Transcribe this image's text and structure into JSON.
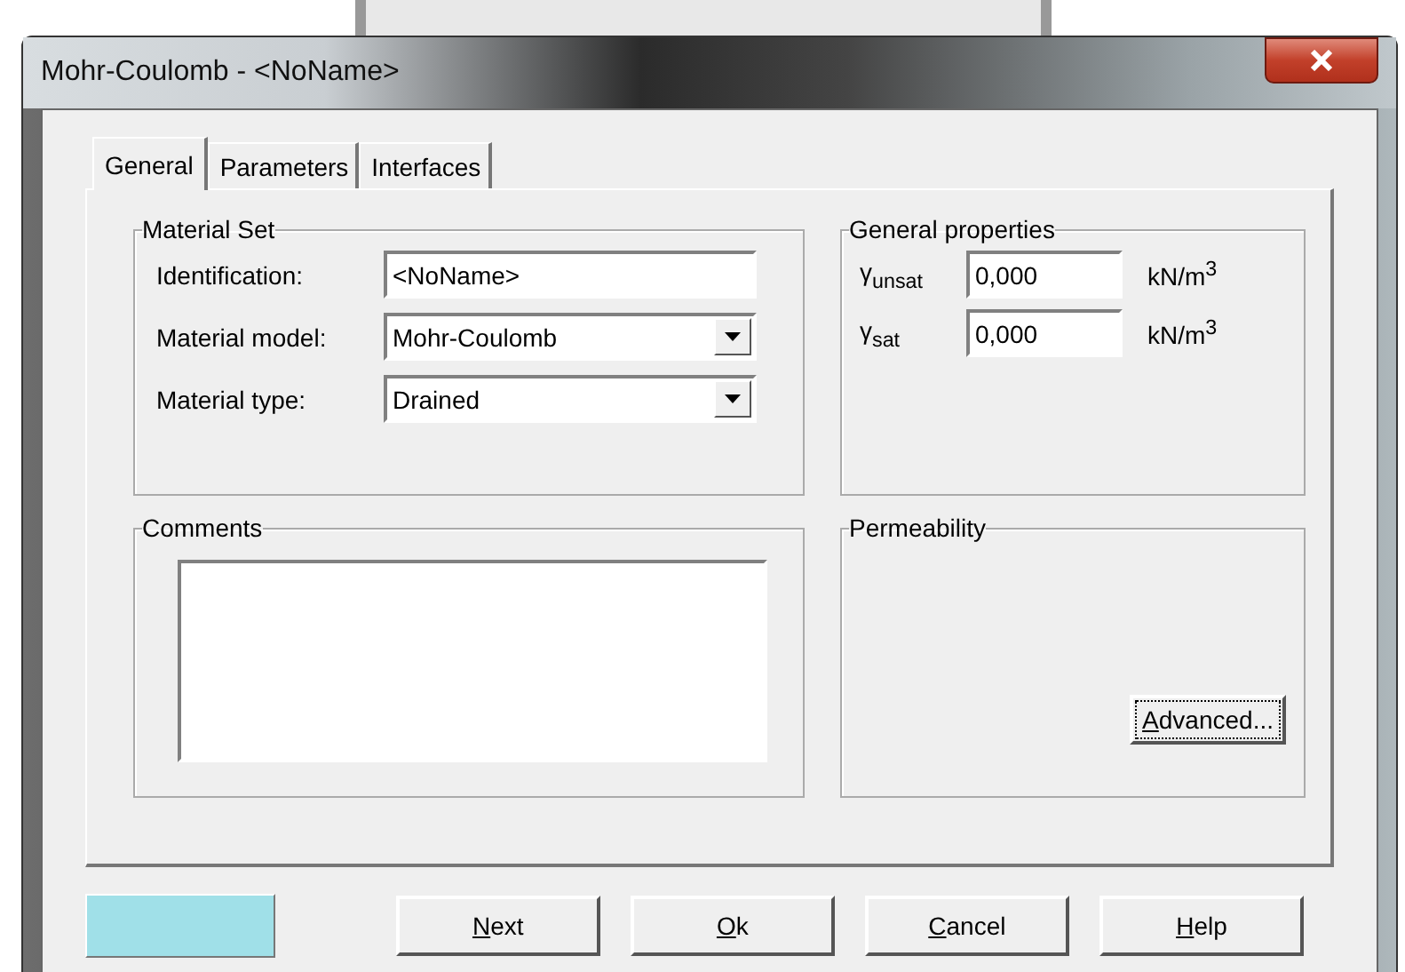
{
  "window": {
    "title": "Mohr-Coulomb - <NoName>"
  },
  "tabs": [
    {
      "label": "General",
      "selected": true
    },
    {
      "label": "Parameters",
      "selected": false
    },
    {
      "label": "Interfaces",
      "selected": false
    }
  ],
  "material_set": {
    "title": "Material Set",
    "fields": [
      {
        "kind": "text",
        "label": "Identification:",
        "value": "<NoName>"
      },
      {
        "kind": "dropdown",
        "label": "Material model:",
        "value": "Mohr-Coulomb"
      },
      {
        "kind": "dropdown",
        "label": "Material type:",
        "value": "Drained"
      }
    ]
  },
  "general_properties": {
    "title": "General properties",
    "fields": [
      {
        "label": "γ$_{unsat}$",
        "value": "0,000",
        "unit": "kN/m$^{3}$"
      },
      {
        "label": "γ$_{sat}$",
        "value": "0,000",
        "unit": "kN/m$^{3}$"
      }
    ]
  },
  "comments": {
    "title": "Comments"
  },
  "permeability": {
    "title": "Permeability",
    "button": "Advanced..."
  },
  "buttons": [
    "Next",
    "Ok",
    "Cancel",
    "Help"
  ]
}
